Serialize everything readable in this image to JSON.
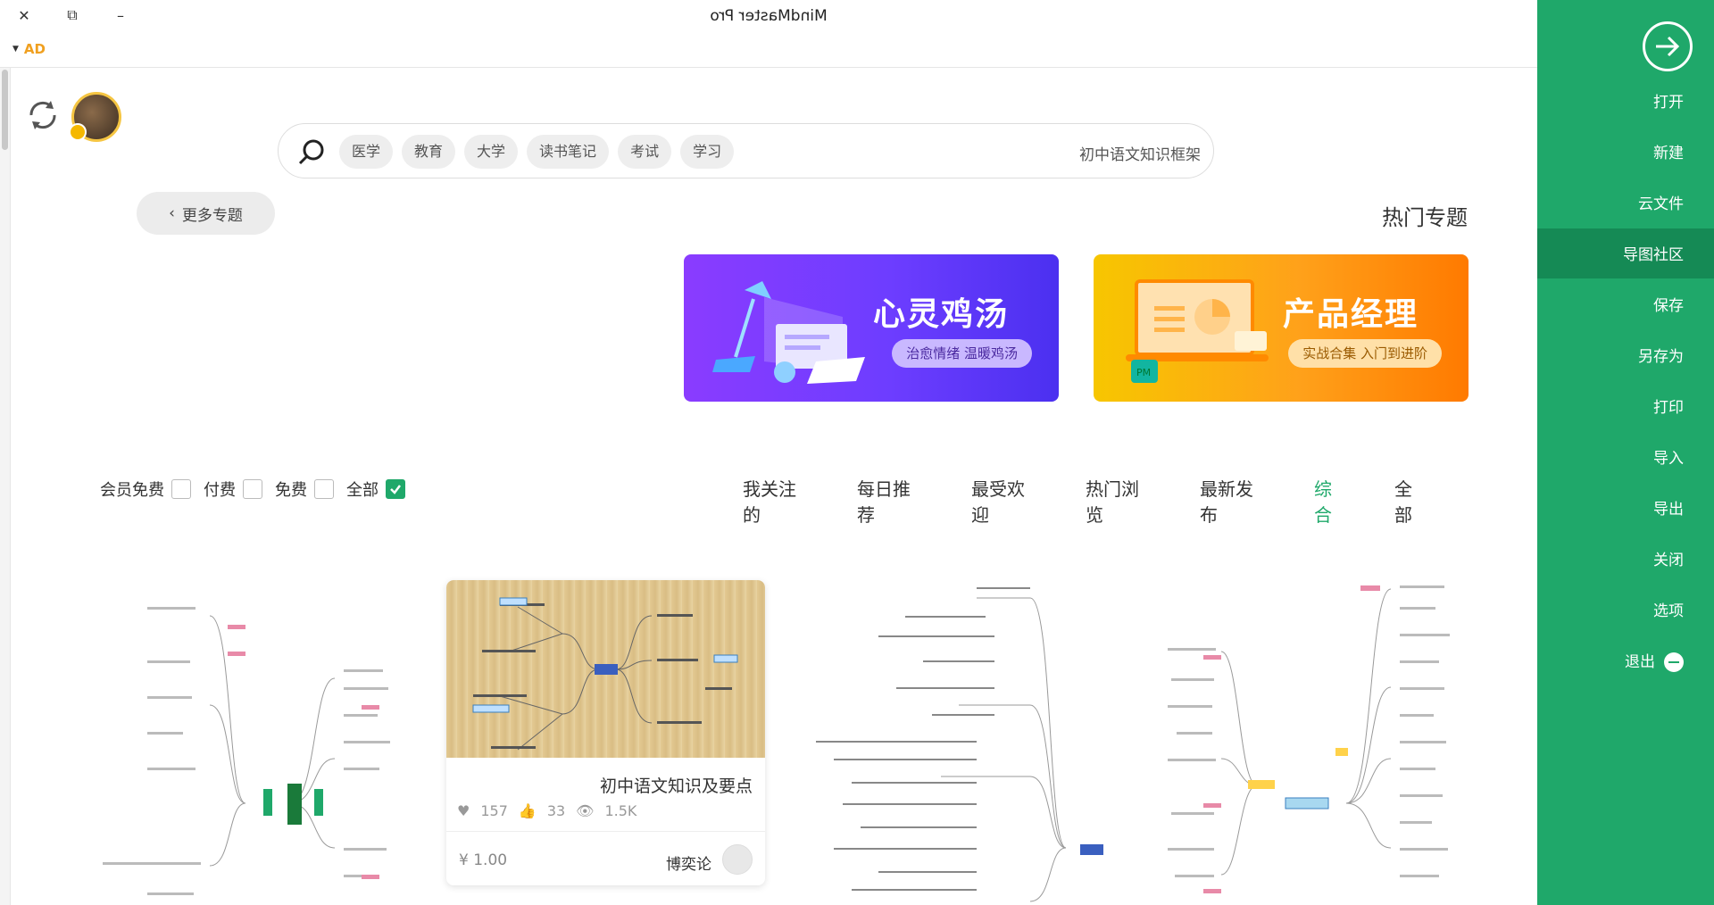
{
  "window": {
    "title": "MindMaster Pro",
    "controls": [
      "✕",
      "⧉",
      "–"
    ]
  },
  "ad": {
    "label": "AD"
  },
  "sidebar": {
    "items": [
      {
        "label": "打开"
      },
      {
        "label": "新建"
      },
      {
        "label": "云文件"
      },
      {
        "label": "导图社区"
      },
      {
        "label": "保存"
      },
      {
        "label": "另存为"
      },
      {
        "label": "打印"
      },
      {
        "label": "导入"
      },
      {
        "label": "导出"
      },
      {
        "label": "关闭"
      },
      {
        "label": "选项"
      },
      {
        "label": "退出"
      }
    ],
    "active_index": 3,
    "colors": {
      "bg": "#1fa86a",
      "active": "#158a55"
    }
  },
  "search": {
    "placeholder": "初中语文知识框架",
    "tags": [
      "医学",
      "教育",
      "大学",
      "读书笔记",
      "考试",
      "学习"
    ]
  },
  "topics": {
    "title": "热门专题",
    "more_label": "更多专题",
    "banners": [
      {
        "title": "产品经理",
        "subtitle": "实战合集 入门到进阶",
        "badge": "PM"
      },
      {
        "title": "心灵鸡汤",
        "subtitle": "治愈情绪 温暖鸡汤"
      }
    ]
  },
  "tabs": {
    "items": [
      "全部",
      "综合",
      "最新发布",
      "热门浏览",
      "最受欢迎",
      "每日推荐",
      "我关注的"
    ],
    "active_index": 1
  },
  "filters": [
    {
      "label": "全部",
      "checked": true
    },
    {
      "label": "免费",
      "checked": false
    },
    {
      "label": "付费",
      "checked": false
    },
    {
      "label": "会员免费",
      "checked": false
    }
  ],
  "featured_card": {
    "title": "初中语文知识及要点",
    "views": "1.5K",
    "likes": "33",
    "favorites": "157",
    "author": "博奕论",
    "price": "¥ 1.00"
  }
}
